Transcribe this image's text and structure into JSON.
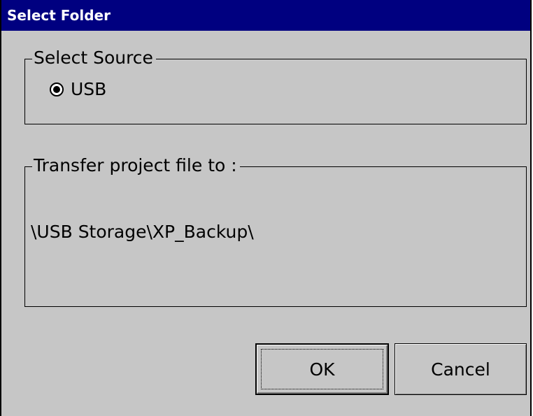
{
  "window": {
    "title": "Select Folder"
  },
  "source_group": {
    "legend": "Select Source",
    "radio_label": "USB",
    "radio_selected": true
  },
  "target_group": {
    "legend": "Transfer project file to :",
    "path": "\\USB Storage\\XP_Backup\\"
  },
  "buttons": {
    "ok_label": "OK",
    "cancel_label": "Cancel"
  },
  "colors": {
    "titlebar_bg": "#000080",
    "titlebar_text": "#ffffff",
    "dialog_bg": "#c6c6c6"
  }
}
